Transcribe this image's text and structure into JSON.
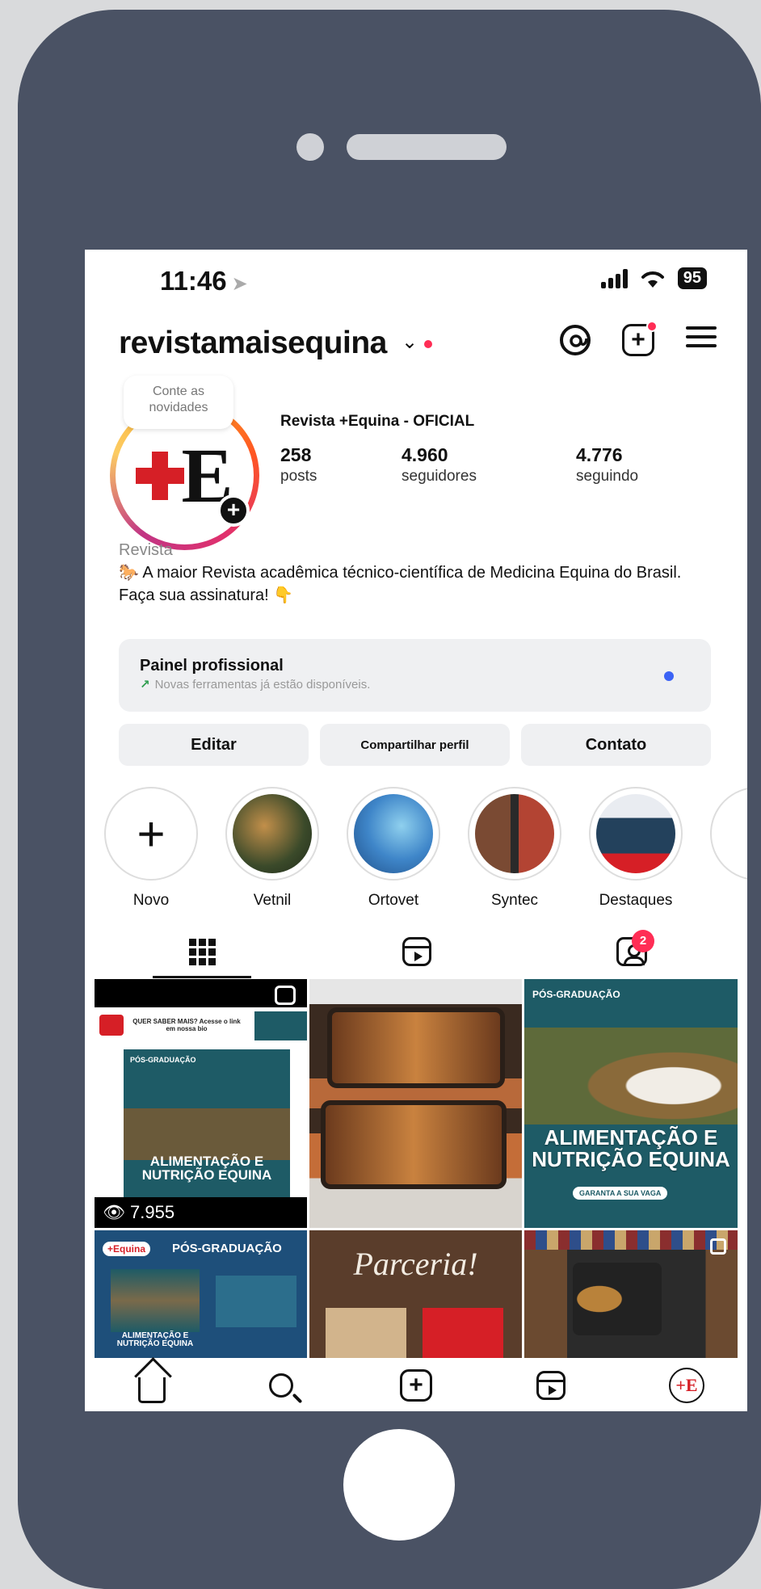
{
  "status_bar": {
    "time": "11:46",
    "battery": "95"
  },
  "header": {
    "username": "revistamaisequina"
  },
  "profile": {
    "note": "Conte as novidades",
    "full_name": "Revista +Equina - OFICIAL",
    "stats": [
      {
        "value": "258",
        "label": "posts"
      },
      {
        "value": "4.960",
        "label": "seguidores"
      },
      {
        "value": "4.776",
        "label": "seguindo"
      }
    ],
    "bio": {
      "category": "Revista",
      "line1": "🐎 A maior Revista acadêmica técnico-científica de Medicina Equina do Brasil.",
      "line2": "Faça sua assinatura! 👇"
    }
  },
  "pro_panel": {
    "title": "Painel profissional",
    "subtitle": "Novas ferramentas já estão disponíveis."
  },
  "actions": {
    "edit": "Editar",
    "share": "Compartilhar perfil",
    "contact": "Contato"
  },
  "highlights": [
    {
      "label": "Novo"
    },
    {
      "label": "Vetnil",
      "color": "#3b4a2a"
    },
    {
      "label": "Ortovet",
      "color": "#3f86c9"
    },
    {
      "label": "Syntec",
      "color": "#7a4a33"
    },
    {
      "label": "Destaques",
      "color": "#e9ecf1"
    }
  ],
  "tabs": {
    "tagged_badge": "2"
  },
  "posts": {
    "p1": {
      "top_text": "QUER SABER MAIS? Acesse o link em nossa bio",
      "badge": "PÓS-GRADUAÇÃO",
      "title": "ALIMENTAÇÃO E NUTRIÇÃO EQUINA",
      "views": "7.955"
    },
    "p3": {
      "badge": "PÓS-GRADUAÇÃO",
      "title": "ALIMENTAÇÃO E NUTRIÇÃO EQUINA",
      "cta": "GARANTA A SUA VAGA"
    },
    "p4": {
      "logo": "+Equina",
      "badge": "PÓS-GRADUAÇÃO",
      "title": "ALIMENTAÇÃO E NUTRIÇÃO EQUINA"
    },
    "p5": {
      "title": "Parceria!"
    }
  },
  "colors": {
    "accent_red": "#d61f26",
    "notification": "#ff2d55",
    "link_blue": "#3b63f5",
    "post_teal": "#1e5b66"
  }
}
